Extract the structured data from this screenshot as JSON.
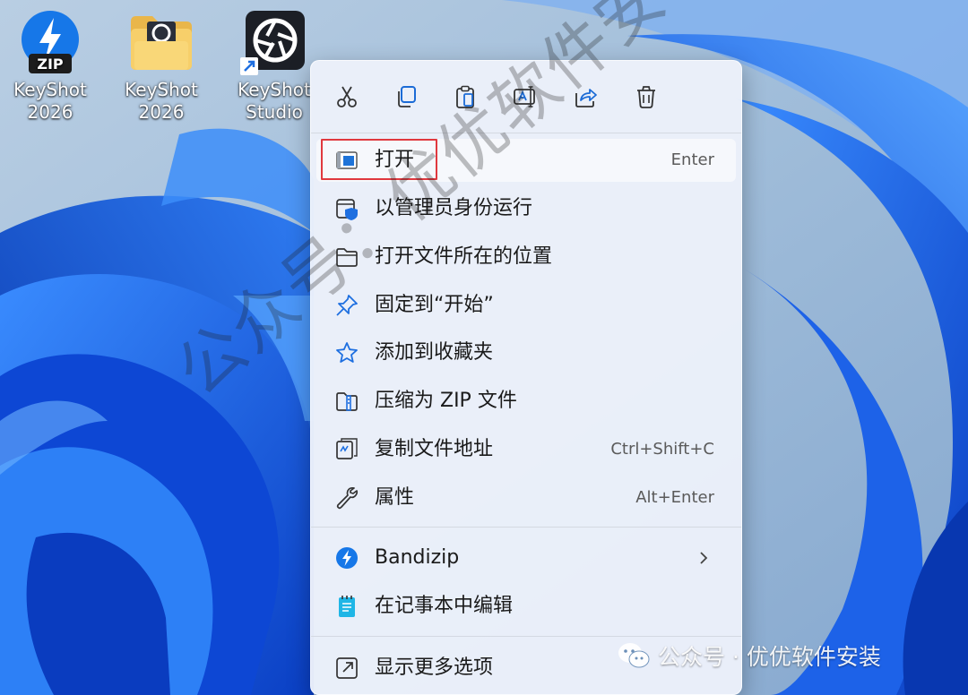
{
  "desktop": {
    "icons": [
      {
        "name": "KeyShot",
        "name2": "2026",
        "icon": "bandizip-zip-icon"
      },
      {
        "name": "KeyShot",
        "name2": "2026",
        "icon": "folder-icon"
      },
      {
        "name": "KeyShot",
        "name2": "Studio",
        "icon": "keyshot-studio-shortcut-icon"
      }
    ]
  },
  "context_menu": {
    "quick_actions": [
      {
        "id": "cut",
        "icon": "scissors-icon"
      },
      {
        "id": "copy",
        "icon": "copy-icon"
      },
      {
        "id": "paste",
        "icon": "clipboard-icon"
      },
      {
        "id": "rename",
        "icon": "rename-icon"
      },
      {
        "id": "share",
        "icon": "share-icon"
      },
      {
        "id": "delete",
        "icon": "trash-icon"
      }
    ],
    "items": [
      {
        "label": "打开",
        "shortcut": "Enter",
        "icon": "open-window-icon"
      },
      {
        "label": "以管理员身份运行",
        "shortcut": "",
        "icon": "admin-shield-icon"
      },
      {
        "label": "打开文件所在的位置",
        "shortcut": "",
        "icon": "folder-outline-icon"
      },
      {
        "label": "固定到“开始”",
        "shortcut": "",
        "icon": "pin-icon"
      },
      {
        "label": "添加到收藏夹",
        "shortcut": "",
        "icon": "star-icon"
      },
      {
        "label": "压缩为 ZIP 文件",
        "shortcut": "",
        "icon": "zip-folder-icon"
      },
      {
        "label": "复制文件地址",
        "shortcut": "Ctrl+Shift+C",
        "icon": "copy-path-icon"
      },
      {
        "label": "属性",
        "shortcut": "Alt+Enter",
        "icon": "wrench-icon"
      },
      {
        "label": "Bandizip",
        "shortcut": "",
        "icon": "bandizip-icon"
      },
      {
        "label": "在记事本中编辑",
        "shortcut": "",
        "icon": "notepad-icon"
      },
      {
        "label": "显示更多选项",
        "shortcut": "",
        "icon": "show-more-icon"
      }
    ],
    "highlight_color": "#e0383e"
  },
  "watermark": {
    "diagonal_text": "公众号：优优软件安装",
    "badge_text": "公众号 · 优优软件安装"
  },
  "colors": {
    "accent": "#0a5bd6",
    "wallpaper_bg": "#a9c2dc"
  }
}
